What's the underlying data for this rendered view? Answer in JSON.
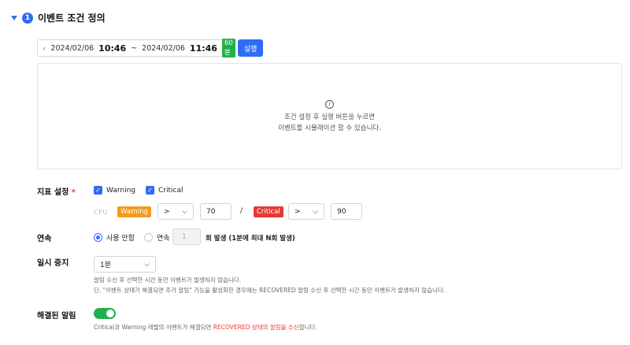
{
  "section": {
    "number": "1",
    "title": "이벤트 조건 정의"
  },
  "time_range": {
    "start_date": "2024/02/06",
    "start_time": "10:46",
    "separator": "~",
    "end_date": "2024/02/06",
    "end_time": "11:46",
    "duration": "60분"
  },
  "run_button": "실행",
  "simulation": {
    "line1": "조건 설정 후 실행 버튼을 누르면",
    "line2": "이벤트를 시뮬레이션 할 수 있습니다."
  },
  "metric": {
    "label": "지표 설정",
    "required_mark": "*",
    "warning_label": "Warning",
    "critical_label": "Critical",
    "metric_name": "CPU",
    "warning_chip": "Warning",
    "warning_operator": ">",
    "warning_value": "70",
    "slash": "/",
    "critical_chip": "Critical",
    "critical_operator": ">",
    "critical_value": "90"
  },
  "consecutive": {
    "label": "연속",
    "option_off": "사용 안함",
    "option_on": "연속",
    "count_placeholder": "1",
    "suffix": "회 발생 (1분에 최대 N회 발생)"
  },
  "pause": {
    "label": "일시 중지",
    "value": "1분",
    "help1": "알림 수신 후 선택한 시간 동안 이벤트가 발생하지 않습니다.",
    "help2": "단, \"이벤트 상태가 해결되면 추가 알림\" 기능을 활성화한 경우에는 RECOVERED 알림 수신 후 선택한 시간 동안 이벤트가 발생하지 않습니다."
  },
  "resolved": {
    "label": "해결된 알림",
    "toggle_on": true,
    "help_prefix": "Critical과 Warning 레벨의 이벤트가 해결되면 ",
    "help_highlight": "RECOVERED 상태의 알림을 수신",
    "help_suffix": "합니다."
  },
  "colors": {
    "accent": "#2f6df6",
    "success": "#1fb24a",
    "warning": "#f39a1b",
    "critical": "#e53935"
  }
}
